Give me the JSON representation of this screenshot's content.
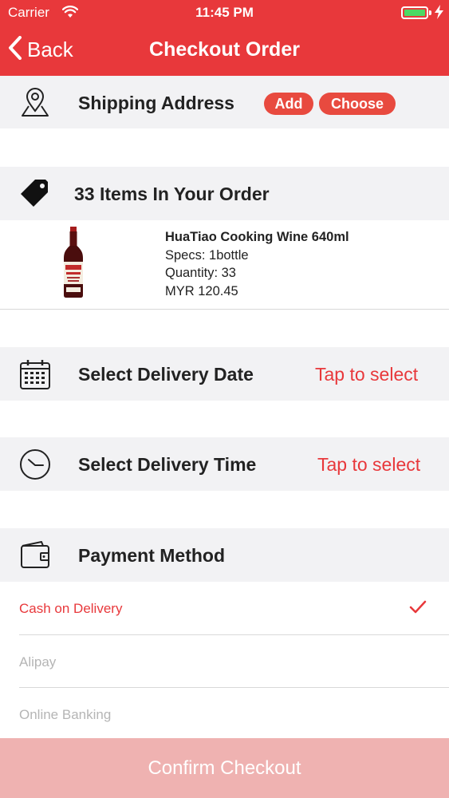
{
  "status_bar": {
    "carrier": "Carrier",
    "time": "11:45 PM",
    "wifi_icon": "wifi-icon",
    "battery_icon": "battery-icon",
    "charging_icon": "bolt-icon"
  },
  "nav": {
    "back_label": "Back",
    "title": "Checkout Order",
    "back_icon": "chevron-left-icon"
  },
  "shipping": {
    "title": "Shipping Address",
    "icon": "location-pin-icon",
    "add_label": "Add",
    "choose_label": "Choose"
  },
  "order": {
    "title": "33 Items In Your Order",
    "icon": "price-tag-icon",
    "items": [
      {
        "name": "HuaTiao Cooking Wine 640ml",
        "specs": "Specs: 1bottle",
        "quantity": "Quantity: 33",
        "price": "MYR 120.45"
      }
    ]
  },
  "delivery_date": {
    "title": "Select Delivery Date",
    "icon": "calendar-icon",
    "action": "Tap to select"
  },
  "delivery_time": {
    "title": "Select Delivery Time",
    "icon": "clock-icon",
    "action": "Tap to select"
  },
  "payment": {
    "title": "Payment Method",
    "icon": "wallet-icon",
    "options": [
      {
        "label": "Cash on Delivery",
        "selected": true
      },
      {
        "label": "Alipay",
        "selected": false
      },
      {
        "label": "Online Banking",
        "selected": false
      }
    ],
    "check_icon": "checkmark-icon"
  },
  "confirm_label": "Confirm Checkout",
  "colors": {
    "accent": "#e8383b",
    "section_bg": "#f2f2f4",
    "confirm_disabled": "#efb2b1",
    "unselected_text": "#b5b5b5"
  }
}
